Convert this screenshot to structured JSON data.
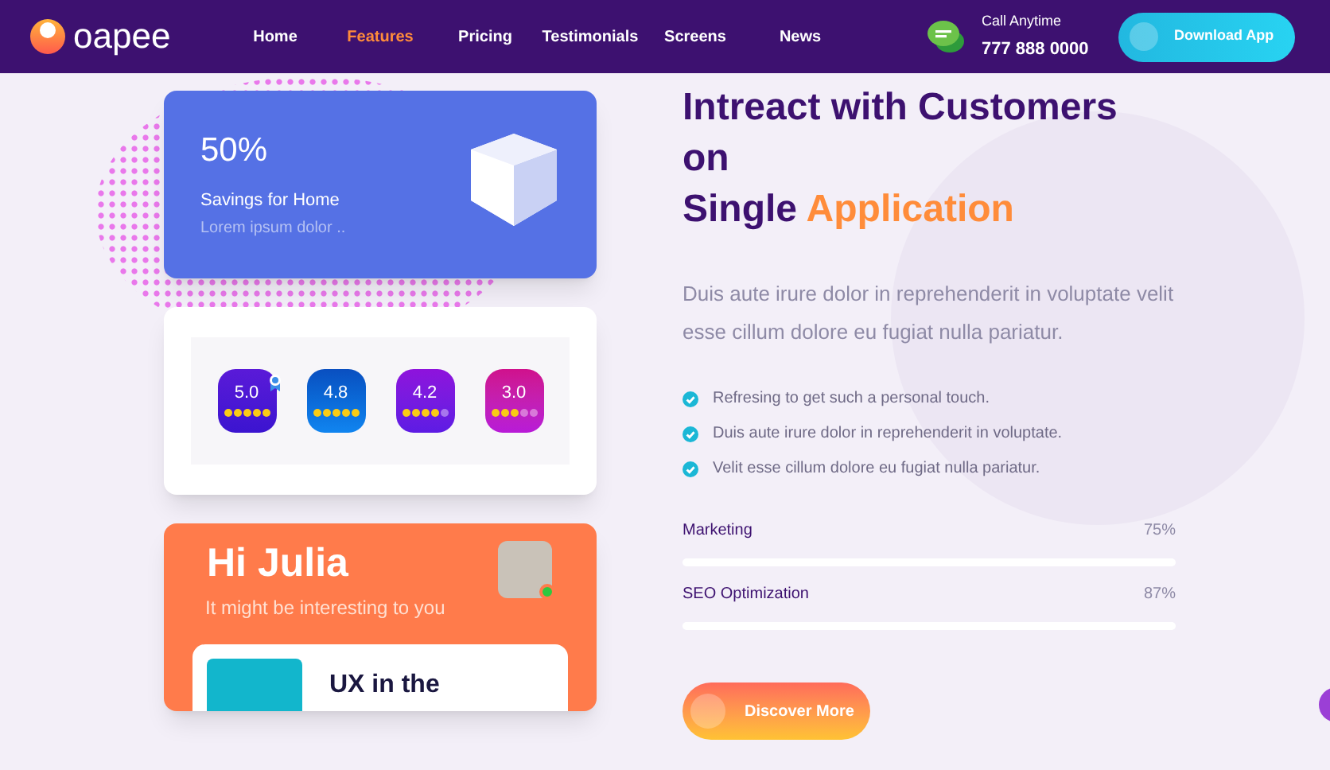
{
  "logo": {
    "text": "oapee"
  },
  "nav": [
    {
      "label": "Home",
      "selected": false
    },
    {
      "label": "Features",
      "selected": true
    },
    {
      "label": "Pricing",
      "selected": false
    },
    {
      "label": "Testimonials",
      "selected": false
    },
    {
      "label": "Screens",
      "selected": false
    },
    {
      "label": "News",
      "selected": false
    }
  ],
  "contact": {
    "label": "Call Anytime",
    "phone": "777 888 0000"
  },
  "download_button": "Download App",
  "savings_card": {
    "value": "50%",
    "title": "Savings for Home",
    "subtitle": "Lorem ipsum dolor .."
  },
  "ratings": [
    {
      "score": "5.0",
      "stars": 5,
      "badge": true
    },
    {
      "score": "4.8",
      "stars": 5,
      "badge": false
    },
    {
      "score": "4.2",
      "stars": 4,
      "badge": false
    },
    {
      "score": "3.0",
      "stars": 3,
      "badge": false
    }
  ],
  "greeting_card": {
    "title": "Hi Julia",
    "subtitle": "It might be interesting to you",
    "online": true,
    "article_title": "UX in the"
  },
  "heading": {
    "lines": [
      "Intreact with Customers",
      "on"
    ],
    "last_line": "Single",
    "highlight": "Application"
  },
  "description": "Duis aute irure dolor in reprehenderit in voluptate velit esse cillum dolore eu fugiat nulla pariatur.",
  "features": [
    "Refresing to get such a personal touch.",
    "Duis aute irure dolor in reprehenderit in voluptate.",
    "Velit esse cillum dolore eu fugiat nulla pariatur."
  ],
  "skills": [
    {
      "name": "Marketing",
      "reading": "75%"
    },
    {
      "name": "SEO Optimization",
      "reading": "87%"
    }
  ],
  "discover_button": "Discover More"
}
